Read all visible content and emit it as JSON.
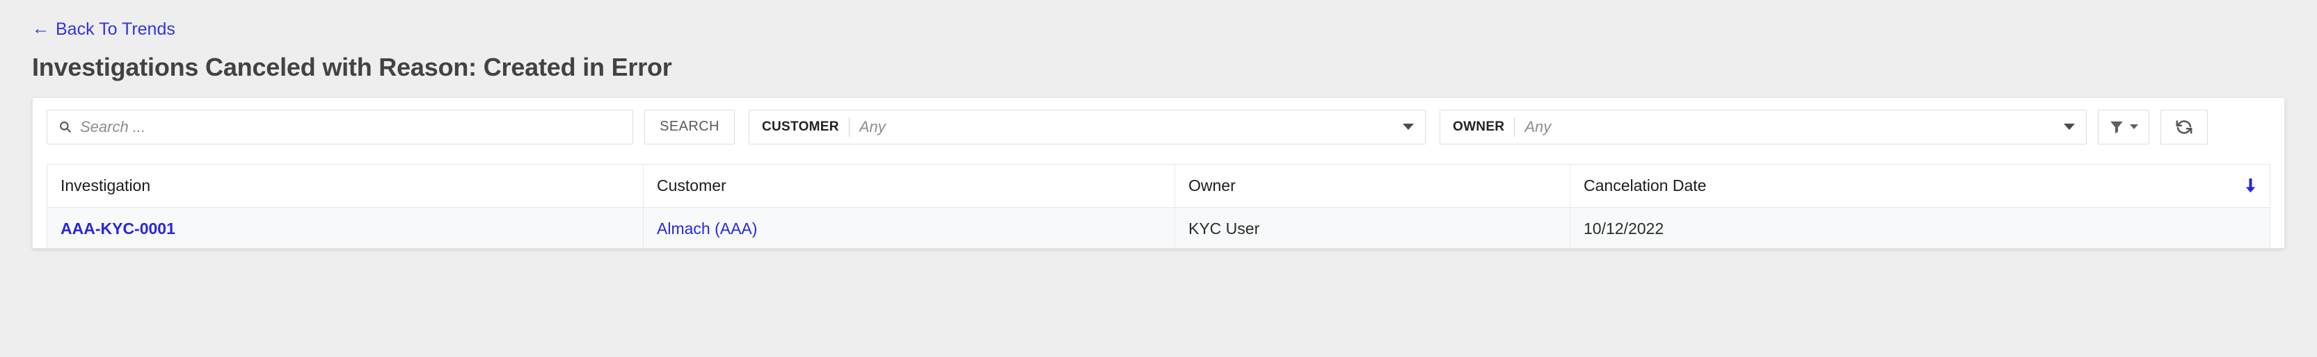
{
  "breadcrumb": {
    "back_label": "Back To Trends",
    "back_arrow": "←",
    "link_color": "#3434e0"
  },
  "header": {
    "title": "Investigations Canceled with Reason: Created in Error"
  },
  "toolbar": {
    "search": {
      "icon": "search-icon",
      "value": "",
      "placeholder": "Search ..."
    },
    "search_button_label": "SEARCH",
    "customer_filter": {
      "label": "CUSTOMER",
      "value": "",
      "placeholder": "Any",
      "icon": "chevron-down-icon"
    },
    "owner_filter": {
      "label": "OWNER",
      "value": "",
      "placeholder": "Any",
      "icon": "chevron-down-icon"
    },
    "filter_button": {
      "icon": "funnel-icon",
      "caret": "chevron-down-icon"
    },
    "refresh_button": {
      "icon": "refresh-icon"
    }
  },
  "table": {
    "columns": [
      {
        "key": "investigation",
        "label": "Investigation"
      },
      {
        "key": "customer",
        "label": "Customer"
      },
      {
        "key": "owner",
        "label": "Owner"
      },
      {
        "key": "cancelation_date",
        "label": "Cancelation Date"
      }
    ],
    "sort": {
      "column": "Cancelation Date",
      "direction": "descending",
      "icon": "arrow-down-icon",
      "color": "#2727e0"
    },
    "rows": [
      {
        "investigation": "AAA-KYC-0001",
        "customer": "Almach (AAA)",
        "owner": "KYC User",
        "cancelation_date": "10/12/2022"
      }
    ]
  },
  "colors": {
    "page_background": "#eeeeee",
    "card_background": "#ffffff",
    "row_background": "#f8f9fa",
    "title_text": "#424242",
    "link": "#2727e0"
  }
}
